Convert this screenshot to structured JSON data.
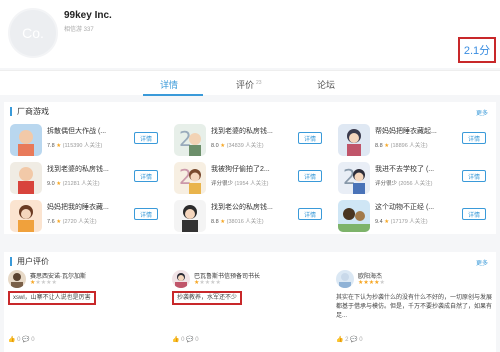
{
  "developer": {
    "name": "99key Inc.",
    "sub": "相信游 337",
    "logo_text": "Co.",
    "score": "2.1分"
  },
  "tabs": [
    {
      "label": "详情",
      "count": ""
    },
    {
      "label": "评价",
      "count": "23"
    },
    {
      "label": "论坛",
      "count": ""
    }
  ],
  "games_section": {
    "title": "厂商游戏",
    "more": "更多",
    "detail_label": "详情",
    "games": [
      {
        "title": "拆散偶但大作战 (...",
        "score": "7.8",
        "stars": "★",
        "users": "(115390 人关注)"
      },
      {
        "title": "找到老婆的私房钱...",
        "score": "8.0",
        "stars": "★",
        "users": "(34839 人关注)"
      },
      {
        "title": "帮妈妈把睡衣藏起...",
        "score": "8.8",
        "stars": "★",
        "users": "(18896 人关注)"
      },
      {
        "title": "找到老婆的私房钱...",
        "score": "9.0",
        "stars": "★",
        "users": "(21281 人关注)"
      },
      {
        "title": "我被狗仔偷拍了2...",
        "score": "评分很少",
        "stars": "",
        "users": "(1954 人关注)"
      },
      {
        "title": "我进不去学校了 (...",
        "score": "评分很少",
        "stars": "",
        "users": "(2056 人关注)"
      },
      {
        "title": "妈妈把我的睡衣藏...",
        "score": "7.6",
        "stars": "★",
        "users": "(2720 人关注)"
      },
      {
        "title": "找到老公的私房钱...",
        "score": "8.8",
        "stars": "★",
        "users": "(38016 人关注)"
      },
      {
        "title": "这个动物不正经 (...",
        "score": "9.4",
        "stars": "★",
        "users": "(17179 人关注)"
      }
    ]
  },
  "reviews_section": {
    "title": "用户评价",
    "more": "更多",
    "reviews": [
      {
        "name": "赛思西安诺·瓦尔加斯",
        "stars_on": "★",
        "stars_off": "★★★★",
        "text": "xswl，山寨不让人说也是厉害",
        "footer": "👍 0   💬 0"
      },
      {
        "name": "巴瓦鲁斯书信预备司书长",
        "stars_on": "★",
        "stars_off": "★★★★",
        "text": "抄袭教养，水军还不少",
        "footer": "👍 0   💬 0"
      },
      {
        "name": "欧阳海杰",
        "stars_on": "★★★★",
        "stars_off": "★",
        "text": "其实在下认为抄袭什么的没有什么不好的，一切原创与发展都基于借承与模仿。但是，千万不要抄袭成自然了，如果有足...",
        "footer": "👍 2   💬 0"
      }
    ]
  },
  "colors": {
    "accent": "#3a9ad9",
    "highlight_box": "#c8282a",
    "star": "#f6a623"
  }
}
